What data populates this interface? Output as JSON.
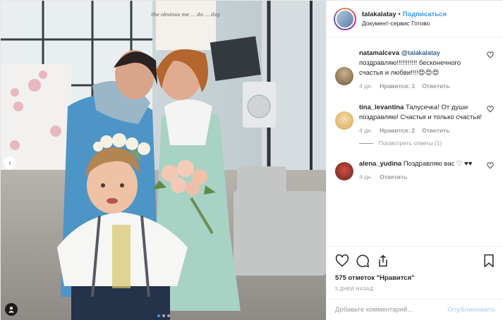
{
  "post": {
    "username": "talakalatay",
    "follow_label": "Подписаться",
    "separator": "•",
    "location": "Документ-сервис Готово",
    "sign_text": "the obvious me ... do ... day"
  },
  "comments": [
    {
      "user": "natamalceva",
      "mention": "@talakalatay",
      "text": "поздравляю!!!!!!!!!!! бесконечного счастья и любви!!!!😍😍😍",
      "time": "4 дн.",
      "likes": "Нравится: 1",
      "reply": "Ответить"
    },
    {
      "user": "tina_levantina",
      "mention": "",
      "text": "Талусечка! От души поздравляю! Счастья и только счастья!",
      "time": "4 дн.",
      "likes": "Нравится: 2",
      "reply": "Ответить",
      "view_replies": "Посмотреть ответы (1)"
    },
    {
      "user": "alena_yudina",
      "mention": "",
      "text": "Поздравляю вас ♡ ♥♥",
      "time": "4 дн.",
      "likes": "",
      "reply": "Ответить"
    }
  ],
  "actions": {
    "likes_count": "575 отметок",
    "likes_label": "\"Нравится\"",
    "time_ago": "5 ДНЕЙ НАЗАД"
  },
  "add_comment": {
    "placeholder": "Добавьте комментарий...",
    "publish": "Опубликовать"
  },
  "icons": [
    "heart-icon",
    "comment-icon",
    "share-icon",
    "bookmark-icon",
    "tag-user-icon",
    "chevron-left-icon"
  ],
  "colors": {
    "accent": "#3897f0",
    "text": "#262626",
    "muted": "#999999",
    "border": "#efefef"
  }
}
